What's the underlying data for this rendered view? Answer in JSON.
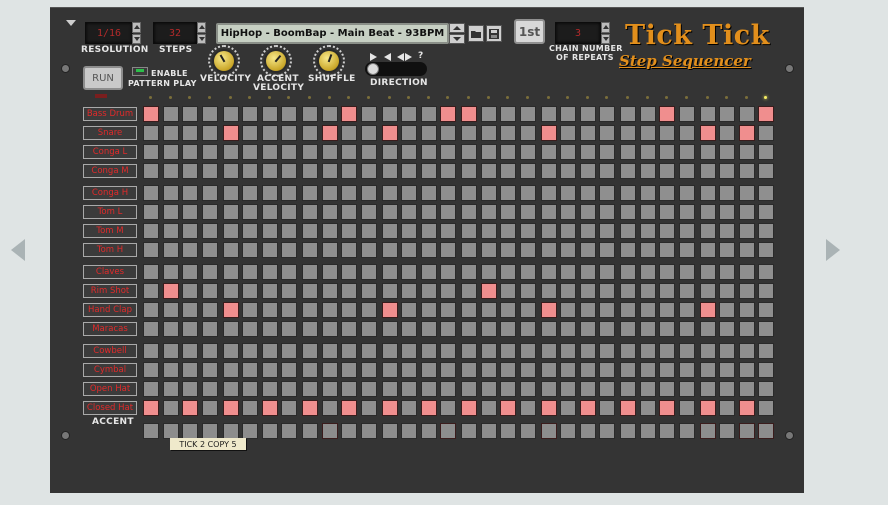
{
  "device": {
    "resolution_label": "RESOLUTION",
    "resolution_value": "1/16",
    "steps_label": "STEPS",
    "steps_value": "32",
    "patch_name": "HipHop - BoomBap - Main Beat - 93BPM",
    "first_button": "1st",
    "chain_label_line1": "CHAIN NUMBER",
    "chain_label_line2": "OF REPEATS",
    "chain_value": "3",
    "run_button": "RUN",
    "enable_line1": "ENABLE",
    "enable_line2": "PATTERN PLAY",
    "velocity_label": "VELOCITY",
    "accent_velocity_line1": "ACCENT",
    "accent_velocity_line2": "VELOCITY",
    "shuffle_label": "SHUFFLE",
    "direction_label": "DIRECTION",
    "direction_help": "?",
    "logo_title": "Tick Tick",
    "logo_subtitle": "Step Sequencer",
    "accent_label": "ACCENT",
    "tape_label": "TICK 2 COPY 5",
    "current_step": 32
  },
  "sequencer": {
    "instruments": [
      {
        "label": "Bass Drum",
        "on": [
          1,
          11,
          16,
          17,
          27,
          32
        ]
      },
      {
        "label": "Snare",
        "on": [
          5,
          10,
          13,
          21,
          29,
          31
        ]
      },
      {
        "label": "Conga L",
        "on": []
      },
      {
        "label": "Conga M",
        "on": []
      },
      {
        "label": "Conga H",
        "on": []
      },
      {
        "label": "Tom L",
        "on": []
      },
      {
        "label": "Tom M",
        "on": []
      },
      {
        "label": "Tom H",
        "on": []
      },
      {
        "label": "Claves",
        "on": []
      },
      {
        "label": "Rim Shot",
        "on": [
          2,
          18
        ]
      },
      {
        "label": "Hand Clap",
        "on": [
          5,
          13,
          21,
          29
        ]
      },
      {
        "label": "Maracas",
        "on": []
      },
      {
        "label": "Cowbell",
        "on": []
      },
      {
        "label": "Cymbal",
        "on": []
      },
      {
        "label": "Open Hat",
        "on": []
      },
      {
        "label": "Closed Hat",
        "on": [
          1,
          3,
          5,
          7,
          9,
          11,
          13,
          15,
          17,
          19,
          21,
          23,
          25,
          27,
          29,
          31
        ]
      }
    ],
    "accent_on": [
      10,
      16,
      21,
      29,
      31,
      32
    ]
  }
}
